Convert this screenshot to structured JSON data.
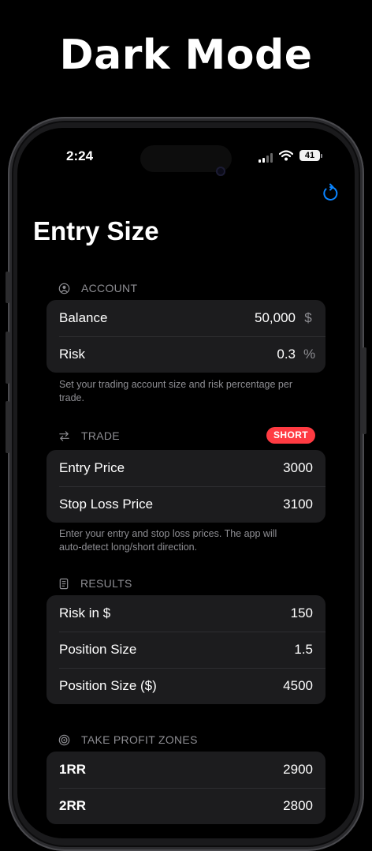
{
  "headline": "Dark Mode",
  "status_bar": {
    "time": "2:24",
    "battery": "41"
  },
  "page_title": "Entry Size",
  "account": {
    "header": "ACCOUNT",
    "rows": [
      {
        "label": "Balance",
        "value": "50,000",
        "unit": "$"
      },
      {
        "label": "Risk",
        "value": "0.3",
        "unit": "%"
      }
    ],
    "footer": "Set your trading account size and risk percentage per trade."
  },
  "trade": {
    "header": "TRADE",
    "badge": "SHORT",
    "rows": [
      {
        "label": "Entry Price",
        "value": "3000"
      },
      {
        "label": "Stop Loss Price",
        "value": "3100"
      }
    ],
    "footer": "Enter your entry and stop loss prices. The app will auto-detect long/short direction."
  },
  "results": {
    "header": "RESULTS",
    "rows": [
      {
        "label": "Risk in $",
        "value": "150"
      },
      {
        "label": "Position Size",
        "value": "1.5"
      },
      {
        "label": "Position Size ($)",
        "value": "4500"
      }
    ]
  },
  "take_profit": {
    "header": "TAKE PROFIT ZONES",
    "rows": [
      {
        "label": "1RR",
        "value": "2900"
      },
      {
        "label": "2RR",
        "value": "2800"
      }
    ]
  },
  "colors": {
    "background": "#000000",
    "card": "#1c1c1e",
    "secondary_text": "#8e8e93",
    "accent": "#0a84ff",
    "short_badge": "#ff3b42"
  }
}
